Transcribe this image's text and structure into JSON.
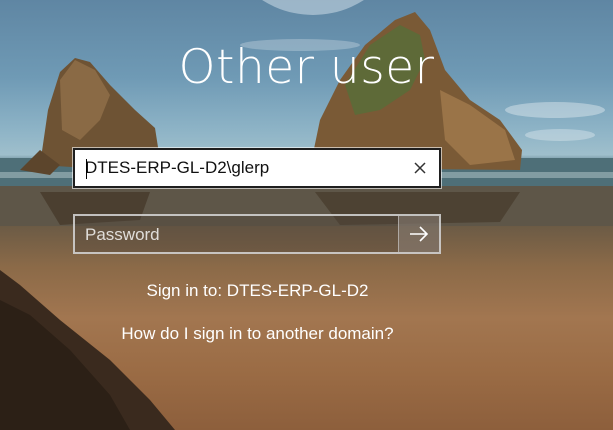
{
  "screen": {
    "title": "Other user"
  },
  "username_field": {
    "value": "DTES-ERP-GL-D2\\glerp",
    "clear_icon": "close-icon"
  },
  "password_field": {
    "placeholder": "Password",
    "submit_icon": "arrow-right-icon"
  },
  "sign_in_to": {
    "text": "Sign in to: DTES-ERP-GL-D2"
  },
  "help_link": {
    "text": "How do I sign in to another domain?"
  }
}
